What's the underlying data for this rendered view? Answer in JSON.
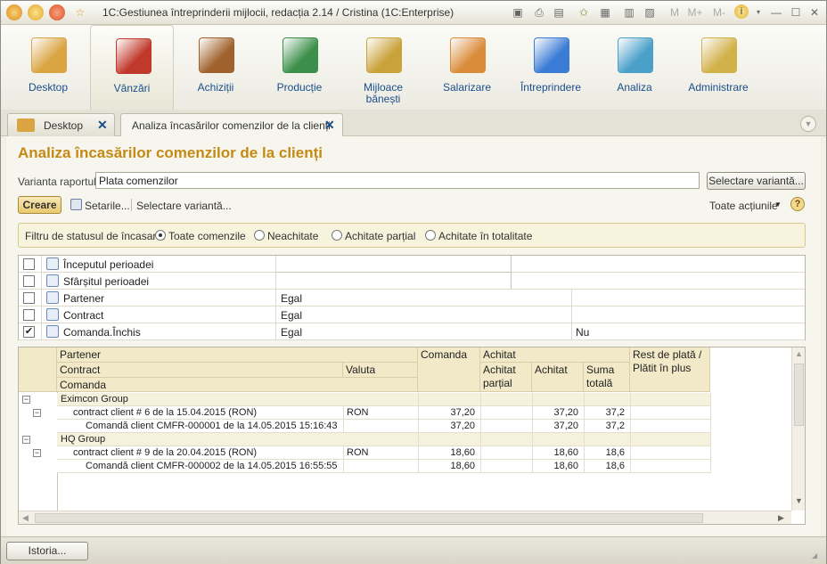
{
  "titlebar": {
    "title": "1C:Gestiunea întreprinderii mijlocii, redacția 2.14 / Cristina  (1C:Enterprise)",
    "icons": [
      "app-logo-icon",
      "menu-icon",
      "close-circle-icon",
      "favorite-icon",
      "save-icon",
      "print-icon",
      "preview-icon",
      "add-favorite-icon",
      "favorites-icon",
      "calculator-icon",
      "calendar-icon",
      "memory-icon",
      "info-icon",
      "minimize-icon",
      "maximize-icon",
      "close-icon"
    ],
    "m_buttons": [
      "M",
      "M+",
      "M-"
    ]
  },
  "sections": [
    {
      "label": "Desktop",
      "icon": "desktop-icon",
      "color": "#d9a441"
    },
    {
      "label": "Vânzări",
      "icon": "sales-basket-icon",
      "color": "#c0392b"
    },
    {
      "label": "Achiziții",
      "icon": "purchases-boxes-icon",
      "color": "#a0622c"
    },
    {
      "label": "Producție",
      "icon": "production-icon",
      "color": "#3b8f4a"
    },
    {
      "label": "Mijloace bănești",
      "icon": "money-icon",
      "color": "#c9a33a"
    },
    {
      "label": "Salarizare",
      "icon": "payroll-person-icon",
      "color": "#d98c3a"
    },
    {
      "label": "Întreprindere",
      "icon": "enterprise-building-icon",
      "color": "#3a7bd5"
    },
    {
      "label": "Analiza",
      "icon": "analysis-chart-icon",
      "color": "#4aa0c9"
    },
    {
      "label": "Administrare",
      "icon": "administration-db-icon",
      "color": "#d1b14a"
    }
  ],
  "tabs": [
    {
      "label": "Desktop",
      "close": "✕"
    },
    {
      "label": "Analiza încasărilor comenzilor de la clienți",
      "close": "✕"
    }
  ],
  "form": {
    "title": "Analiza încasărilor comenzilor de la clienți",
    "variant_label": "Varianta raportului:",
    "variant_value": "Plata comenzilor",
    "select_variant_button": "Selectare variantă...",
    "create_button": "Creare",
    "settings_link": "Setarile...",
    "select_variant_link": "Selectare variantă...",
    "all_actions": "Toate acțiunile",
    "help": "?"
  },
  "filter": {
    "label": "Filtru de statusul de încasare:",
    "options": [
      {
        "label": "Toate comenzile",
        "selected": true
      },
      {
        "label": "Neachitate",
        "selected": false
      },
      {
        "label": "Achitate parțial",
        "selected": false
      },
      {
        "label": "Achitate în totalitate",
        "selected": false
      }
    ]
  },
  "settings": [
    {
      "checked": false,
      "field": "Începutul perioadei",
      "condition": "",
      "value": ""
    },
    {
      "checked": false,
      "field": "Sfârșitul perioadei",
      "condition": "",
      "value": ""
    },
    {
      "checked": false,
      "field": "Partener",
      "condition": "Egal",
      "value": ""
    },
    {
      "checked": false,
      "field": "Contract",
      "condition": "Egal",
      "value": ""
    },
    {
      "checked": true,
      "field": "Comanda.Închis",
      "condition": "Egal",
      "value": "Nu"
    }
  ],
  "report": {
    "headers": {
      "partener": "Partener",
      "contract": "Contract",
      "valuta": "Valuta",
      "comanda": "Comanda",
      "comanda_col": "Comanda",
      "achitat": "Achitat",
      "achitat_partial": "Achitat parțial",
      "achitat_sub": "Achitat",
      "suma_totala": "Suma totală",
      "rest": "Rest de plată / Plătit în plus"
    },
    "rows": [
      {
        "level": 0,
        "name": "Eximcon Group",
        "valuta": "",
        "comanda": "",
        "partial": "",
        "achitat": "",
        "suma": ""
      },
      {
        "level": 1,
        "name": "contract client # 6 de la 15.04.2015 (RON)",
        "valuta": "RON",
        "comanda": "37,20",
        "partial": "",
        "achitat": "37,20",
        "suma": "37,2"
      },
      {
        "level": 2,
        "name": "Comandă client CMFR-000001 de la 14.05.2015 15:16:43",
        "valuta": "",
        "comanda": "37,20",
        "partial": "",
        "achitat": "37,20",
        "suma": "37,2"
      },
      {
        "level": 0,
        "name": "HQ Group",
        "valuta": "",
        "comanda": "",
        "partial": "",
        "achitat": "",
        "suma": ""
      },
      {
        "level": 1,
        "name": "contract client # 9 de la 20.04.2015 (RON)",
        "valuta": "RON",
        "comanda": "18,60",
        "partial": "",
        "achitat": "18,60",
        "suma": "18,6"
      },
      {
        "level": 2,
        "name": "Comandă client CMFR-000002 de la 14.05.2015 16:55:55",
        "valuta": "",
        "comanda": "18,60",
        "partial": "",
        "achitat": "18,60",
        "suma": "18,6"
      }
    ]
  },
  "statusbar": {
    "history_button": "Istoria..."
  }
}
